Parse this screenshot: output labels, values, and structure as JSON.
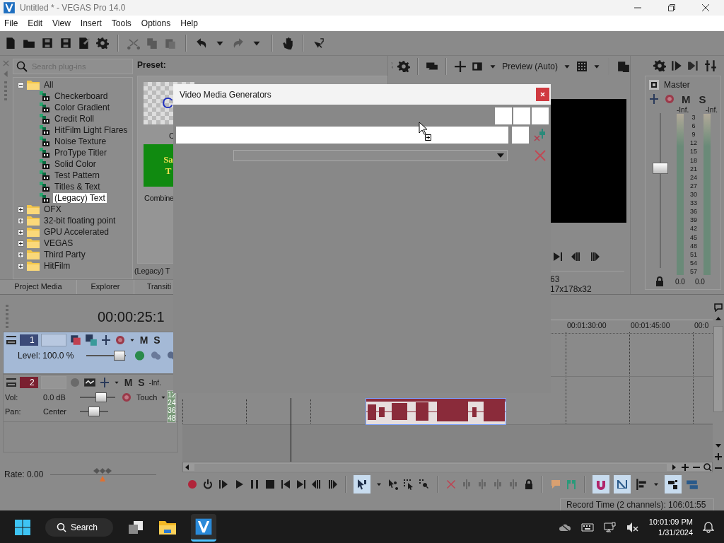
{
  "window": {
    "title": "Untitled * - VEGAS Pro 14.0"
  },
  "menu": [
    "File",
    "Edit",
    "View",
    "Insert",
    "Tools",
    "Options",
    "Help"
  ],
  "plugin_browser": {
    "search": {
      "placeholder": "Search plug-ins"
    },
    "tree": [
      {
        "label": "All",
        "expanded": true,
        "selected": false,
        "children": [
          {
            "label": "Checkerboard",
            "selected": false
          },
          {
            "label": "Color Gradient",
            "selected": false
          },
          {
            "label": "Credit Roll",
            "selected": false
          },
          {
            "label": "HitFilm Light Flares",
            "selected": false
          },
          {
            "label": "Noise Texture",
            "selected": false
          },
          {
            "label": "ProType Titler",
            "selected": false
          },
          {
            "label": "Solid Color",
            "selected": false
          },
          {
            "label": "Test Pattern",
            "selected": false
          },
          {
            "label": "Titles & Text",
            "selected": false
          },
          {
            "label": "(Legacy) Text",
            "selected": true
          }
        ]
      },
      {
        "label": "OFX",
        "expanded": false,
        "selected": false
      },
      {
        "label": "32-bit floating point",
        "expanded": false,
        "selected": false
      },
      {
        "label": "GPU Accelerated",
        "expanded": false,
        "selected": false
      },
      {
        "label": "VEGAS",
        "expanded": false,
        "selected": false
      },
      {
        "label": "Third Party",
        "expanded": false,
        "selected": false
      },
      {
        "label": "HitFilm",
        "expanded": false,
        "selected": false
      }
    ]
  },
  "presets": {
    "label": "Preset:",
    "items": [
      {
        "kind": "checker",
        "thumb_text": [
          "C"
        ],
        "caption": "C"
      },
      {
        "kind": "green",
        "thumb_text": [
          "Sa",
          "T"
        ],
        "caption": "Combine"
      }
    ],
    "footer": "(Legacy) T"
  },
  "dock_tabs": [
    "Project Media",
    "Explorer",
    "Transiti"
  ],
  "preview": {
    "mode": "Preview (Auto)",
    "info": [
      "63",
      "17x178x32"
    ]
  },
  "master": {
    "label": "Master",
    "mute": "M",
    "solo": "S",
    "peaks": [
      "-Inf.",
      "-Inf."
    ],
    "level": 0.63,
    "ticks": [
      "3",
      "6",
      "9",
      "12",
      "15",
      "18",
      "21",
      "24",
      "27",
      "30",
      "33",
      "36",
      "39",
      "42",
      "45",
      "48",
      "51",
      "54",
      "57"
    ],
    "readings": [
      "0.0",
      "0.0"
    ]
  },
  "timecode": "00:00:25:1",
  "tracks": [
    {
      "kind": "video",
      "number": "1",
      "selected": true,
      "mute": "M",
      "solo": "S",
      "level_label": "Level: 100.0 %",
      "level": 0.85
    },
    {
      "kind": "audio",
      "number": "2",
      "selected": false,
      "mute": "M",
      "solo": "S",
      "peak": "-Inf.",
      "meter": [
        "12",
        "24",
        "36",
        "48"
      ],
      "vol_label": "Vol:",
      "volume": {
        "value": "0.0 dB",
        "level": 0.6
      },
      "automation": "Touch",
      "pan_label": "Pan:",
      "pan": {
        "value": "Center",
        "level": 0.5
      }
    }
  ],
  "rate": "Rate: 0.00",
  "ruler": [
    "00:01:30:00",
    "00:01:45:00",
    "00:0"
  ],
  "toggles": {
    "normal_edit": true,
    "snapping": true,
    "auto_crossfade": true,
    "lock_envelopes": true
  },
  "status": "Record Time (2 channels): 106:01:55",
  "dialog": {
    "title": "Video Media Generators"
  },
  "taskbar": {
    "search": "Search",
    "time": "10:01:09 PM",
    "date": "1/31/2024"
  }
}
